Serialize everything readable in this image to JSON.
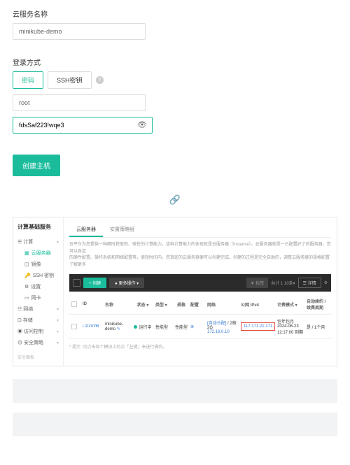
{
  "form": {
    "name_label": "云服务名称",
    "name_value": "minikube-demo",
    "login_label": "登录方式",
    "tab_password": "密码",
    "tab_sshkey": "SSH密钥",
    "user_value": "root",
    "pwd_value": "fdsSaf223!wqe3",
    "create_btn": "创建主机"
  },
  "dashboard": {
    "title": "计算基础服务",
    "nav": {
      "compute": "计算",
      "cloud_server": "云服务器",
      "image": "镜像",
      "ssh_key": "SSH 密钥",
      "settings": "设置",
      "nic": "网卡",
      "network": "网络",
      "storage": "存储",
      "access": "访问控制",
      "security": "安全策略",
      "footer": "安全面板"
    },
    "tabs": {
      "list": "云服务器",
      "recycle": "安置策略组"
    },
    "desc1": "云平台为您提供一种随时获取的、弹性的计算能力，这种计算能力的体现就是云服务器（Instance）。云服务器就是一台配置好了的服务器，您可以自定",
    "desc2": "的硬件配置、操作系统和网络配置等，很短时间内，您指定的云服务器便可以创建完成。创建的过程是完全自助的，调整云服务器的规格配置了解更多",
    "toolbar": {
      "create": "+ 创建",
      "more": "● 更多操作 ▾",
      "filter": "▼ 标签",
      "pager": "共计 1   10条▾",
      "detail": "☰ 详情",
      "gear": "⚙"
    },
    "headers": {
      "id": "ID",
      "name": "名称",
      "status": "状态 ▾",
      "type": "类型 ▾",
      "spec": "规格",
      "conf": "配置",
      "net": "网络",
      "ip": "公网 IPv4",
      "bill": "计费模式 ▾",
      "act": "自动续约 / 续费周期"
    },
    "row": {
      "id": "i-1t2rnf6t",
      "name": "minikube-demo",
      "name_icon": "✎",
      "status": "运行中",
      "type": "性能型",
      "spec": "性能型",
      "conf_icon": "⊕",
      "net_zone": "2核2G",
      "net_ip": "172.16.0.10",
      "net_badge": "[自动分配]",
      "public_ip": "117.171.21.171",
      "bill_type": "包年包月",
      "bill_date": "2024-06-23 12:17:00 到期",
      "act": "是 / 1个月"
    },
    "note": "* 提示: 可点击各个模块上的点「左键」来进行操作。"
  }
}
